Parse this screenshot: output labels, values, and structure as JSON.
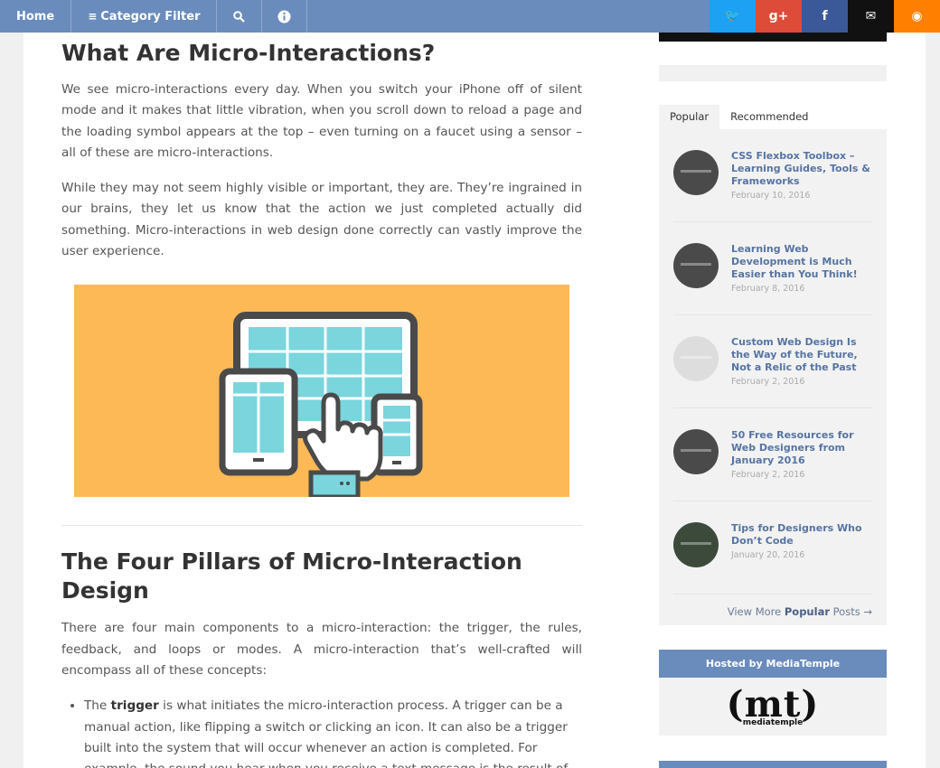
{
  "topbar": {
    "home": "Home",
    "category": "Category Filter",
    "search_icon": "search-icon",
    "info_icon": "info-icon",
    "social": [
      {
        "name": "twitter-icon",
        "glyph": "🐦",
        "color": "#1da1f2"
      },
      {
        "name": "google-plus-icon",
        "glyph": "g+",
        "color": "#dd4b39"
      },
      {
        "name": "facebook-icon",
        "glyph": "f",
        "color": "#3b5998"
      },
      {
        "name": "email-icon",
        "glyph": "✉",
        "color": "#111111"
      },
      {
        "name": "rss-icon",
        "glyph": "◉",
        "color": "#ff7f00"
      }
    ]
  },
  "article": {
    "heading1": "What Are Micro-Interactions?",
    "p1": "We see micro-interactions every day. When you switch your iPhone off of silent mode and it makes that little vibration, when you scroll down to reload a page and the loading symbol appears at the top – even turning on a faucet using a sensor – all of these are micro-interactions.",
    "p2": "While they may not seem highly visible or important, they are. They’re ingrained in our brains, they let us know that the action we just completed actually did something. Micro-interactions in web design done correctly can vastly improve the user experience.",
    "heading2": "The Four Pillars of Micro-Interaction Design",
    "p3": "There are four main components to a micro-interaction: the trigger, the rules, feedback, and loops or modes. A micro-interaction that’s well-crafted will encompass all of these concepts:",
    "bullet_pre": "The ",
    "bullet_bold": "trigger",
    "bullet_post": " is what initiates the micro-interaction process. A trigger can be a manual action, like flipping a switch or clicking an icon. It can also be a trigger built into the system that will occur whenever an action is completed. For example, the sound you hear when you receive a text message is the result of"
  },
  "sidebar": {
    "tabs": [
      "Popular",
      "Recommended"
    ],
    "posts": [
      {
        "title": "CSS Flexbox Toolbox – Learning Guides, Tools & Frameworks",
        "date": "February 10, 2016"
      },
      {
        "title": "Learning Web Development is Much Easier than You Think!",
        "date": "February 8, 2016"
      },
      {
        "title": "Custom Web Design Is the Way of the Future, Not a Relic of the Past",
        "date": "February 2, 2016"
      },
      {
        "title": "50 Free Resources for Web Designers from January 2016",
        "date": "February 2, 2016"
      },
      {
        "title": "Tips for Designers Who Don’t Code",
        "date": "January 20, 2016"
      }
    ],
    "view_more_pre": "View More ",
    "view_more_bold": "Popular",
    "view_more_post": " Posts →",
    "hosted_title": "Hosted by MediaTemple",
    "logo_text": "(mt)",
    "logo_sub": "mediatemple"
  },
  "colors": {
    "nav": "#6a8cbd",
    "hero_bg": "#fcb955",
    "link": "#5674a3"
  }
}
